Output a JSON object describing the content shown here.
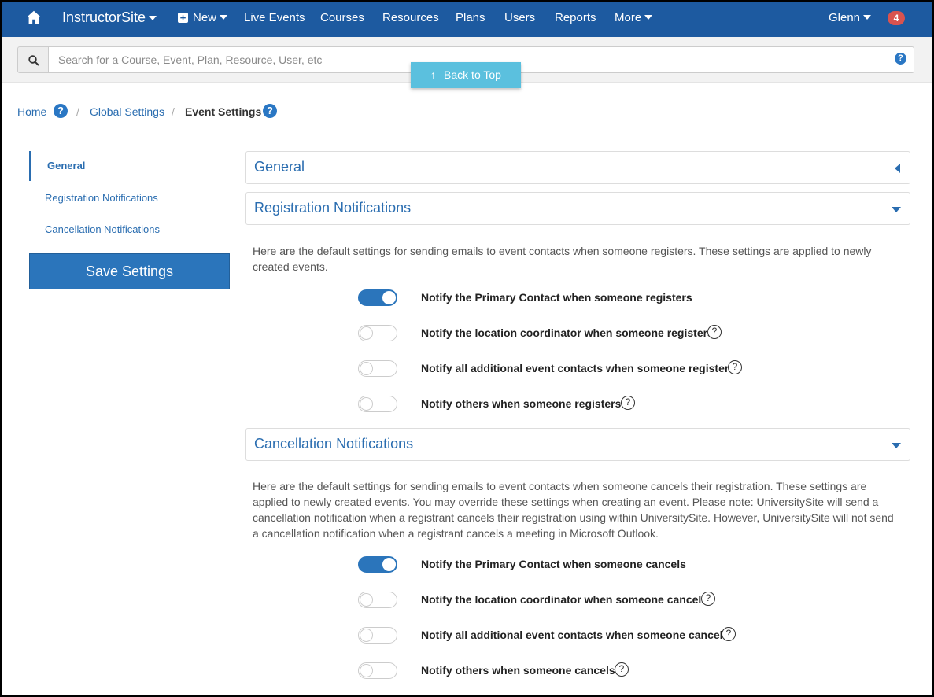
{
  "nav": {
    "brand": "InstructorSite",
    "new_label": "New",
    "items": [
      "Live Events",
      "Courses",
      "Resources",
      "Plans",
      "Users",
      "Reports"
    ],
    "more_label": "More",
    "user": "Glenn",
    "notification_count": "4",
    "color": "#1d5aa0"
  },
  "search": {
    "placeholder": "Search for a Course, Event, Plan, Resource, User, etc"
  },
  "back_to_top": "Back to Top",
  "breadcrumb": {
    "home": "Home",
    "global": "Global Settings",
    "current": "Event Settings",
    "separator": "/"
  },
  "sidebar": {
    "items": [
      "General",
      "Registration Notifications",
      "Cancellation Notifications"
    ],
    "save_label": "Save Settings"
  },
  "sections": {
    "general_title": "General",
    "registration": {
      "title": "Registration Notifications",
      "description": "Here are the default settings for sending emails to event contacts when someone registers. These settings are applied to newly created events.",
      "options": [
        {
          "label": "Notify the Primary Contact when someone registers",
          "on": true
        },
        {
          "label": "Notify the location coordinator when someone registers",
          "on": false
        },
        {
          "label": "Notify all additional event contacts when someone registers",
          "on": false
        },
        {
          "label": "Notify others when someone registers",
          "on": false
        }
      ]
    },
    "cancellation": {
      "title": "Cancellation Notifications",
      "description": "Here are the default settings for sending emails to event contacts when someone cancels their registration. These settings are applied to newly created events. You may override these settings when creating an event. Please note: UniversitySite will send a cancellation notification when a registrant cancels their registration using within UniversitySite. However, UniversitySite will not send a cancellation notification when a registrant cancels a meeting in Microsoft Outlook.",
      "options": [
        {
          "label": "Notify the Primary Contact when someone cancels",
          "on": true
        },
        {
          "label": "Notify the location coordinator when someone cancels",
          "on": false
        },
        {
          "label": "Notify all additional event contacts when someone cancels",
          "on": false
        },
        {
          "label": "Notify others when someone cancels",
          "on": false
        }
      ]
    }
  },
  "help_glyph": "?"
}
